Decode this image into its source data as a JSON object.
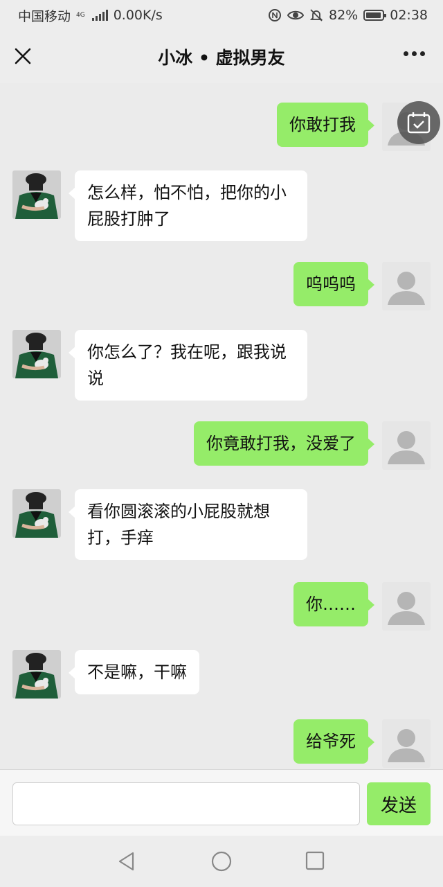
{
  "status_bar": {
    "carrier": "中国移动",
    "network": "4G",
    "speed": "0.00K/s",
    "battery": "82%",
    "time": "02:38"
  },
  "header": {
    "title": "小冰 • 虚拟男友"
  },
  "messages": [
    {
      "side": "right",
      "text": "你敢打我"
    },
    {
      "side": "left",
      "text": "怎么样，怕不怕，把你的小屁股打肿了"
    },
    {
      "side": "right",
      "text": "呜呜呜"
    },
    {
      "side": "left",
      "text": "你怎么了？我在呢，跟我说说"
    },
    {
      "side": "right",
      "text": "你竟敢打我，没爱了"
    },
    {
      "side": "left",
      "text": "看你圆滚滚的小屁股就想打，手痒"
    },
    {
      "side": "right",
      "text": "你……"
    },
    {
      "side": "left",
      "text": "不是嘛，干嘛"
    },
    {
      "side": "right",
      "text": "给爷死"
    }
  ],
  "composer": {
    "value": "",
    "send_label": "发送"
  },
  "colors": {
    "self_bubble": "#95ec69",
    "other_bubble": "#ffffff",
    "background": "#ebebeb"
  },
  "icons": [
    "close-icon",
    "more-icon",
    "calendar-icon",
    "back-icon",
    "home-icon",
    "recents-icon"
  ]
}
